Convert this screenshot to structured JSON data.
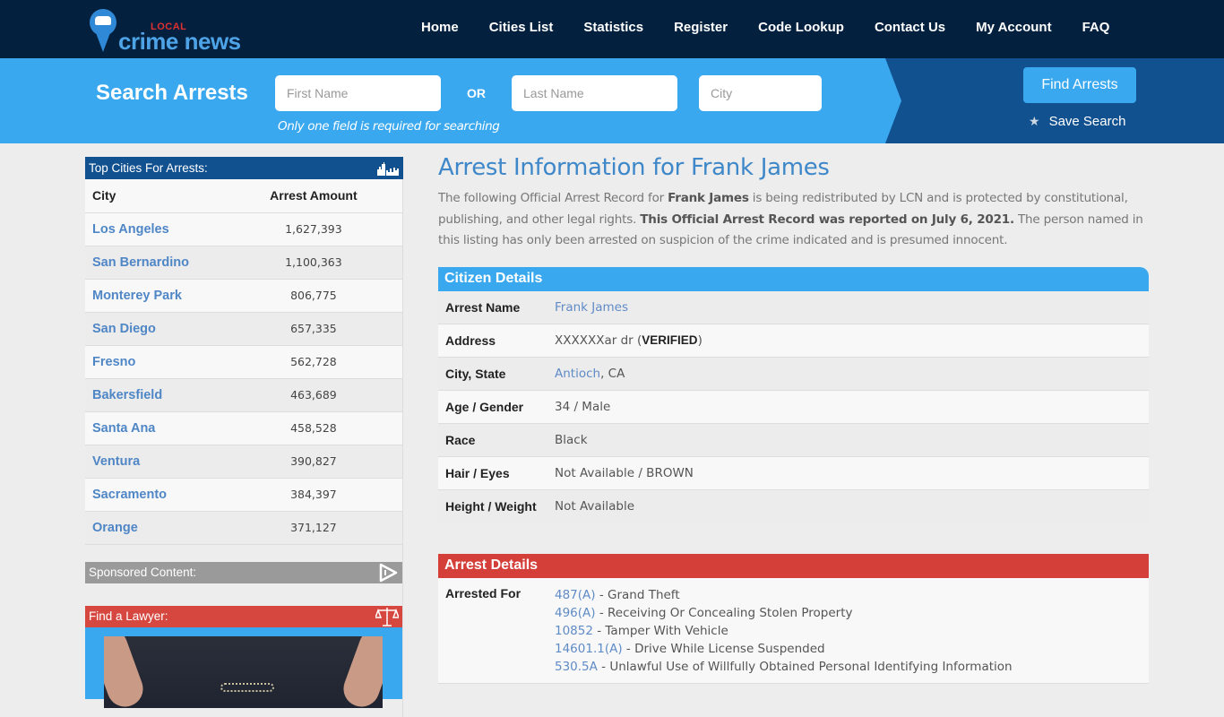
{
  "header": {
    "logo": {
      "top": "LOCAL",
      "main": "crime news"
    },
    "nav": [
      {
        "label": "Home"
      },
      {
        "label": "Cities List"
      },
      {
        "label": "Statistics"
      },
      {
        "label": "Register"
      },
      {
        "label": "Code Lookup"
      },
      {
        "label": "Contact Us"
      },
      {
        "label": "My Account"
      },
      {
        "label": "FAQ"
      }
    ]
  },
  "search": {
    "title": "Search Arrests",
    "first_name": {
      "value": "",
      "placeholder": "First Name"
    },
    "or_label": "OR",
    "last_name": {
      "value": "",
      "placeholder": "Last Name"
    },
    "city": {
      "value": "",
      "placeholder": "City"
    },
    "hint": "Only one field is required for searching",
    "find_button": "Find Arrests",
    "save_search": "Save Search"
  },
  "sidebar": {
    "top_cities_title": "Top Cities For Arrests:",
    "columns": {
      "city": "City",
      "amount": "Arrest Amount"
    },
    "cities": [
      {
        "name": "Los Angeles",
        "amount": "1,627,393"
      },
      {
        "name": "San Bernardino",
        "amount": "1,100,363"
      },
      {
        "name": "Monterey Park",
        "amount": "806,775"
      },
      {
        "name": "San Diego",
        "amount": "657,335"
      },
      {
        "name": "Fresno",
        "amount": "562,728"
      },
      {
        "name": "Bakersfield",
        "amount": "463,689"
      },
      {
        "name": "Santa Ana",
        "amount": "458,528"
      },
      {
        "name": "Ventura",
        "amount": "390,827"
      },
      {
        "name": "Sacramento",
        "amount": "384,397"
      },
      {
        "name": "Orange",
        "amount": "371,127"
      }
    ],
    "sponsored_title": "Sponsored Content:",
    "lawyer_title": "Find a Lawyer:"
  },
  "main": {
    "title": "Arrest Information for Frank James",
    "intro": {
      "p1": "The following Official Arrest Record for ",
      "name": "Frank James",
      "p2": " is being redistributed by LCN and is protected by constitutional, publishing, and other legal rights. ",
      "reported": "This Official Arrest Record was reported on July 6, 2021.",
      "p3": " The person named in this listing has only been arrested on suspicion of the crime indicated and is presumed innocent."
    },
    "citizen": {
      "title": "Citizen Details",
      "arrest_name_label": "Arrest Name",
      "arrest_name": "Frank James",
      "address_label": "Address",
      "address": "XXXXXXar dr (",
      "address_verified": "VERIFIED",
      "address_close": ")",
      "city_state_label": "City, State",
      "city": "Antioch",
      "state": ", CA",
      "age_gender_label": "Age / Gender",
      "age_gender": "34 / Male",
      "race_label": "Race",
      "race": "Black",
      "hair_eyes_label": "Hair / Eyes",
      "hair_eyes": "Not Available / BROWN",
      "height_weight_label": "Height / Weight",
      "height_weight": "Not Available"
    },
    "arrest": {
      "title": "Arrest Details",
      "arrested_for_label": "Arrested For",
      "charges": [
        {
          "code": "487(A)",
          "desc": " - Grand Theft"
        },
        {
          "code": "496(A)",
          "desc": " - Receiving Or Concealing Stolen Property"
        },
        {
          "code": "10852",
          "desc": " - Tamper With Vehicle"
        },
        {
          "code": "14601.1(A)",
          "desc": " - Drive While License Suspended"
        },
        {
          "code": "530.5A",
          "desc": " - Unlawful Use of Willfully Obtained Personal Identifying Information"
        }
      ]
    }
  },
  "colors": {
    "nav_bg": "#03203f",
    "search_bg": "#3aa8ee",
    "search_dark": "#125190",
    "citizen_head": "#3aa8ee",
    "arrest_head": "#d43f3a",
    "link": "#4f86c6"
  }
}
